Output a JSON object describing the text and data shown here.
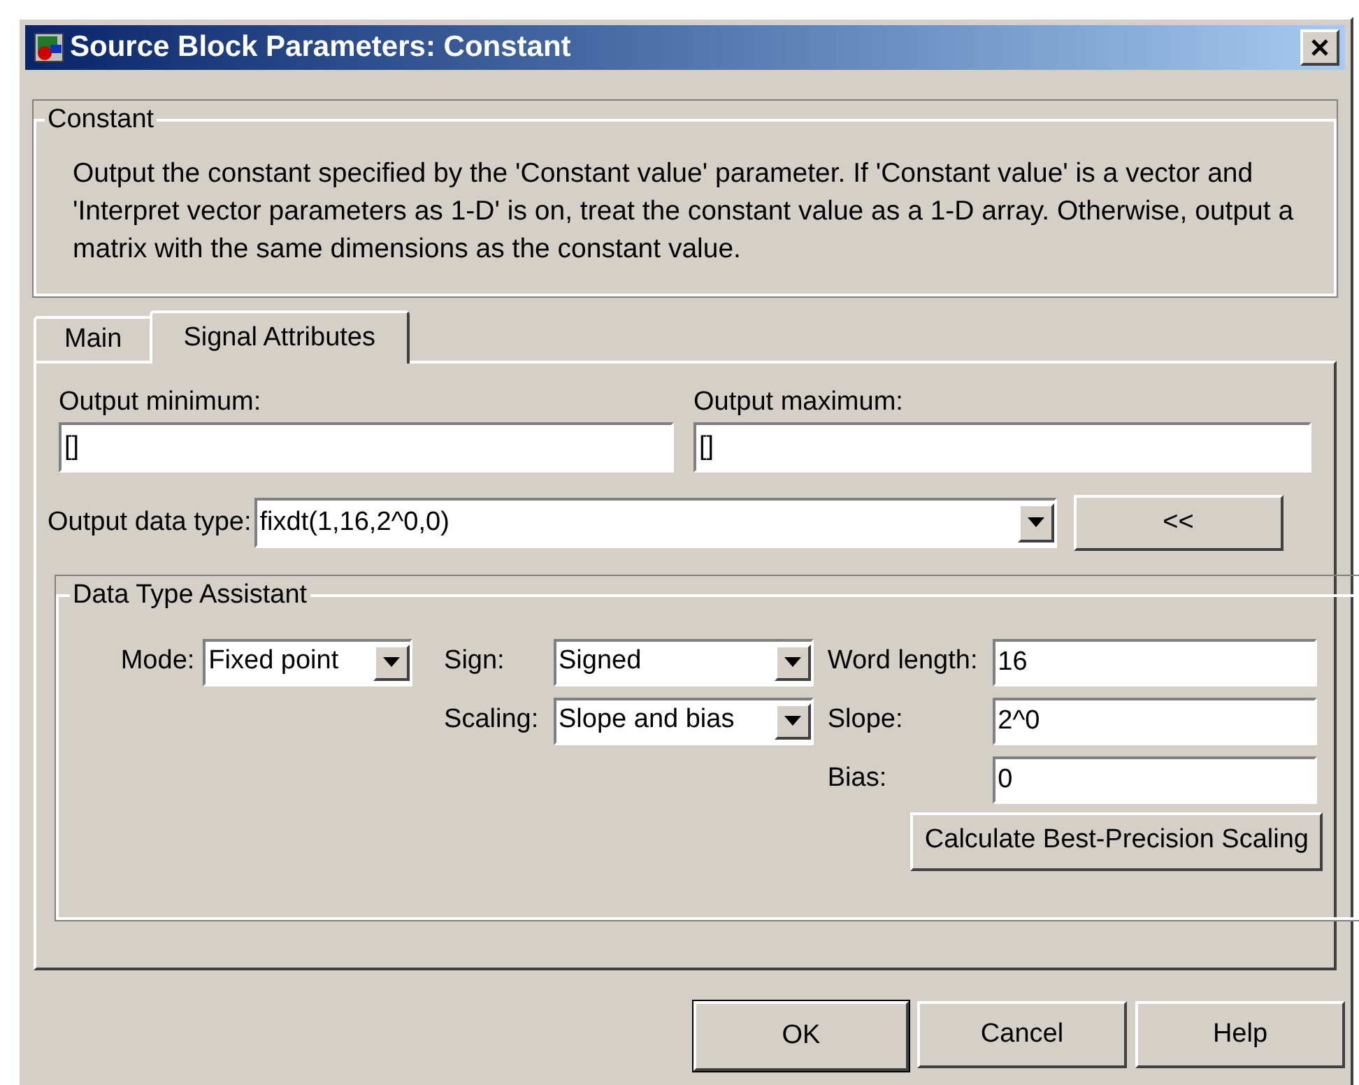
{
  "window": {
    "title": "Source Block Parameters: Constant"
  },
  "description": {
    "legend": "Constant",
    "text": "Output the constant specified by the 'Constant value' parameter. If 'Constant value' is a vector and 'Interpret vector parameters as 1-D' is on, treat the constant value as a 1-D array. Otherwise, output a matrix with the same dimensions as the constant value."
  },
  "tabs": [
    {
      "label": "Main",
      "selected": false
    },
    {
      "label": "Signal Attributes",
      "selected": true
    }
  ],
  "output_minimum": {
    "label": "Output minimum:",
    "value": "[]"
  },
  "output_maximum": {
    "label": "Output maximum:",
    "value": "[]"
  },
  "output_data_type": {
    "label": "Output data type:",
    "value": "fixdt(1,16,2^0,0)",
    "toggle_button": "<<"
  },
  "data_type_assistant": {
    "legend": "Data Type Assistant",
    "mode": {
      "label": "Mode:",
      "value": "Fixed point"
    },
    "sign": {
      "label": "Sign:",
      "value": "Signed"
    },
    "scaling": {
      "label": "Scaling:",
      "value": "Slope and bias"
    },
    "word_length": {
      "label": "Word length:",
      "value": "16"
    },
    "slope": {
      "label": "Slope:",
      "value": "2^0"
    },
    "bias": {
      "label": "Bias:",
      "value": "0"
    },
    "calculate_button": "Calculate Best-Precision Scaling"
  },
  "buttons": [
    {
      "label": "OK",
      "default": true
    },
    {
      "label": "Cancel",
      "default": false
    },
    {
      "label": "Help",
      "default": false
    }
  ]
}
